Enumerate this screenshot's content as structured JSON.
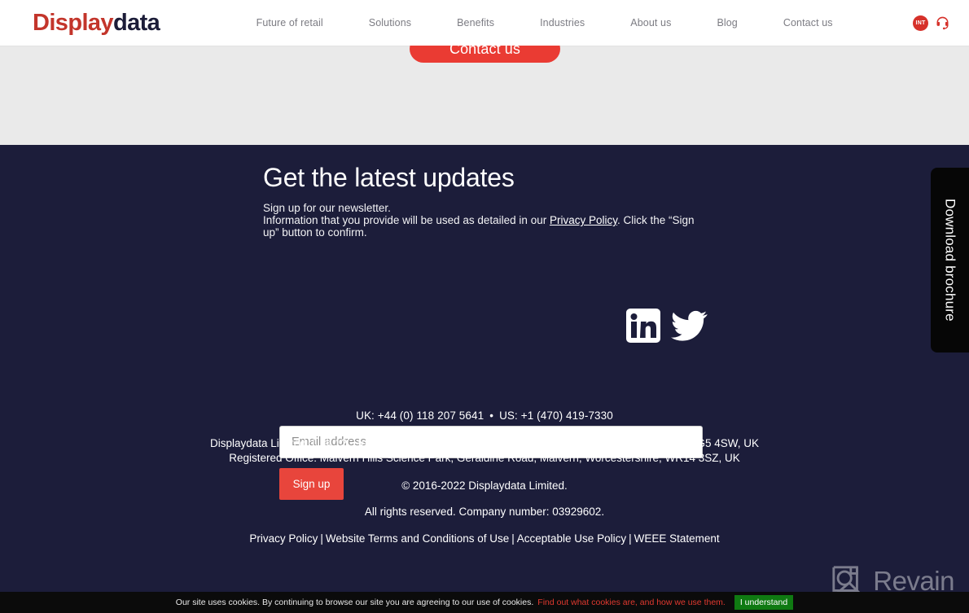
{
  "header": {
    "logo_primary": "Display",
    "logo_secondary": "data",
    "nav": [
      {
        "label": "Future of retail"
      },
      {
        "label": "Solutions"
      },
      {
        "label": "Benefits"
      },
      {
        "label": "Industries"
      },
      {
        "label": "About us"
      },
      {
        "label": "Blog"
      },
      {
        "label": "Contact us"
      }
    ],
    "int_badge": "INT",
    "support_icon": "headset-icon"
  },
  "content": {
    "contact_cta": "Contact us"
  },
  "footer": {
    "newsletter": {
      "heading": "Get the latest updates",
      "copy_line1": "Sign up for our newsletter.",
      "copy_line2_a": "Information that you provide will be used as detailed in our ",
      "privacy_link": "Privacy Policy",
      "copy_line2_b": ". Click the “Sign up” button to confirm.",
      "email_placeholder": "Email address",
      "email_value": "",
      "signup_label": "Sign up"
    },
    "social": [
      {
        "name": "linkedin-icon"
      },
      {
        "name": "twitter-icon"
      }
    ],
    "phone_uk": "UK: +44 (0) 118 207 5641",
    "phone_separator": "•",
    "phone_us": "US: +1 (470) 419-7330",
    "address_line1": "Displaydata Limited. Unit 12, Headley Park 10, Headley Road East, Woodley, Reading, Berkshire, RG5 4SW, UK",
    "address_line2": "Registered Office: Malvern Hills Science Park, Geraldine Road, Malvern, Worcestershire, WR14 3SZ, UK",
    "copyright": "© 2016-2022 Displaydata Limited.",
    "rights": "All rights reserved. Company number: 03929602.",
    "legal_links": [
      {
        "label": "Privacy Policy"
      },
      {
        "label": "Website Terms and Conditions of Use"
      },
      {
        "label": "Acceptable Use Policy"
      },
      {
        "label": "WEEE Statement"
      }
    ],
    "legal_separator": "|"
  },
  "brochure_tab": {
    "label": "Download brochure"
  },
  "watermark": {
    "label": "Revain"
  },
  "cookie_bar": {
    "text": "Our site uses cookies. By continuing to browse our site you are agreeing to our use of cookies.",
    "link": "Find out what cookies are, and how we use them.",
    "accept_label": "I understand"
  },
  "colors": {
    "brand_red": "#c3352b",
    "accent_red": "#ea3b33",
    "footer_navy": "#1c1d3a",
    "strip_grey": "#eaeaea",
    "cookie_green": "#0f7a12",
    "cookie_link_red": "#e0392f"
  }
}
